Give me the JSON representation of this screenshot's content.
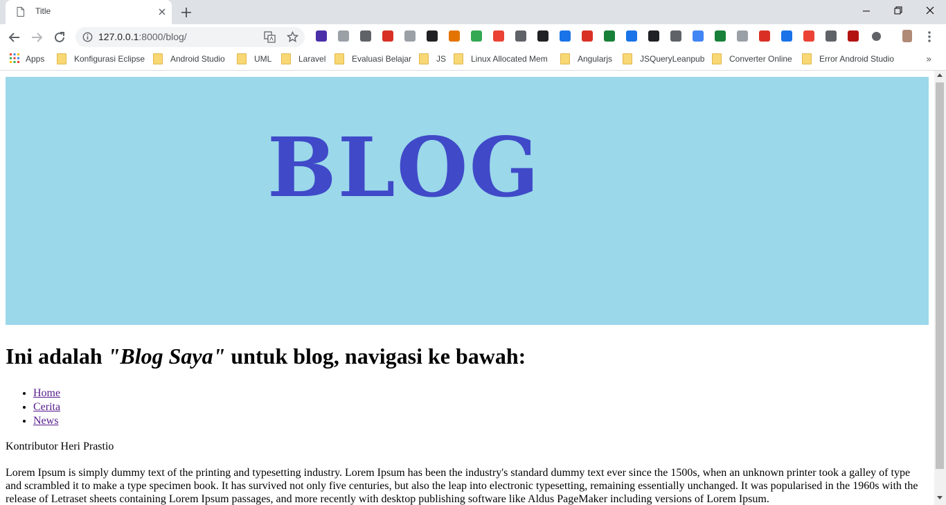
{
  "tab": {
    "title": "Title"
  },
  "address": {
    "host": "127.0.0.1",
    "path": ":8000/blog/"
  },
  "bookmarks": {
    "apps_label": "Apps",
    "items": [
      "Konfigurasi Eclipse",
      "Android Studio",
      "UML",
      "Laravel",
      "Evaluasi Belajar",
      "JS",
      "Linux Allocated Mem",
      "Angularjs",
      "JSQueryLeanpub",
      "Converter Online",
      "Error Android Studio"
    ],
    "more": "»"
  },
  "extensions": {
    "colors": [
      "#4b2fa8",
      "#9aa0a6",
      "#5f6368",
      "#d93025",
      "#9aa0a6",
      "#202124",
      "#e37400",
      "#34a853",
      "#ea4335",
      "#5f6368",
      "#202124",
      "#1a73e8",
      "#d93025",
      "#188038",
      "#1a73e8",
      "#202124",
      "#5f6368",
      "#4285f4",
      "#188038",
      "#9aa0a6",
      "#d93025",
      "#1a73e8",
      "#ea4335",
      "#5f6368",
      "#b31412",
      "#5f6368"
    ]
  },
  "page": {
    "banner_text": "BLOG",
    "banner_bg": "#9ad8ea",
    "banner_text_color": "#4049c8",
    "heading": {
      "prefix": "Ini adalah ",
      "emphasis": "\"Blog Saya\"",
      "suffix": " untuk blog, navigasi ke bawah:"
    },
    "nav": [
      "Home",
      "Cerita",
      "News"
    ],
    "contributor": "Kontributor Heri Prastio",
    "lorem": "Lorem Ipsum is simply dummy text of the printing and typesetting industry. Lorem Ipsum has been the industry's standard dummy text ever since the 1500s, when an unknown printer took a galley of type and scrambled it to make a type specimen book. It has survived not only five centuries, but also the leap into electronic typesetting, remaining essentially unchanged. It was popularised in the 1960s with the release of Letraset sheets containing Lorem Ipsum passages, and more recently with desktop publishing software like Aldus PageMaker including versions of Lorem Ipsum."
  }
}
